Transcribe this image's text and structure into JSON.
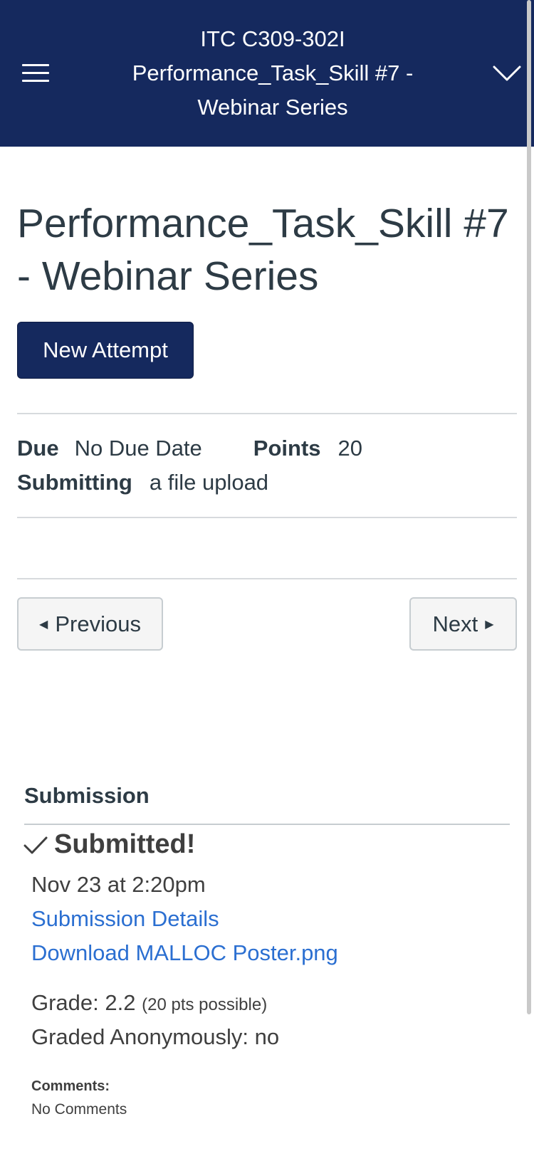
{
  "header": {
    "title_lines": [
      "ITC C309-302I",
      "Performance_Task_Skill #7 -",
      "Webinar Series"
    ],
    "menu_icon": "hamburger-icon",
    "dropdown_icon": "chevron-down-icon",
    "background_color": "#15295e"
  },
  "page": {
    "title_lines": [
      "Performance_Task_Skill #7",
      "- Webinar Series"
    ],
    "new_attempt_label": "New Attempt"
  },
  "details": {
    "due_label": "Due",
    "due_value": "No Due Date",
    "points_label": "Points",
    "points_value": "20",
    "submitting_label": "Submitting",
    "submitting_value": "a file upload"
  },
  "navigation": {
    "previous_label": "Previous",
    "next_label": "Next"
  },
  "submission": {
    "heading": "Submission",
    "status": "Submitted!",
    "status_icon": "checkmark-icon",
    "timestamp": "Nov 23 at 2:20pm",
    "details_link": "Submission Details",
    "download_link": "Download MALLOC Poster.png",
    "grade_label": "Grade: 2.2",
    "grade_possible": "(20 pts possible)",
    "anonymous": "Graded Anonymously: no",
    "comments_label": "Comments:",
    "comments_value": "No Comments",
    "link_color": "#2b6fd1"
  }
}
